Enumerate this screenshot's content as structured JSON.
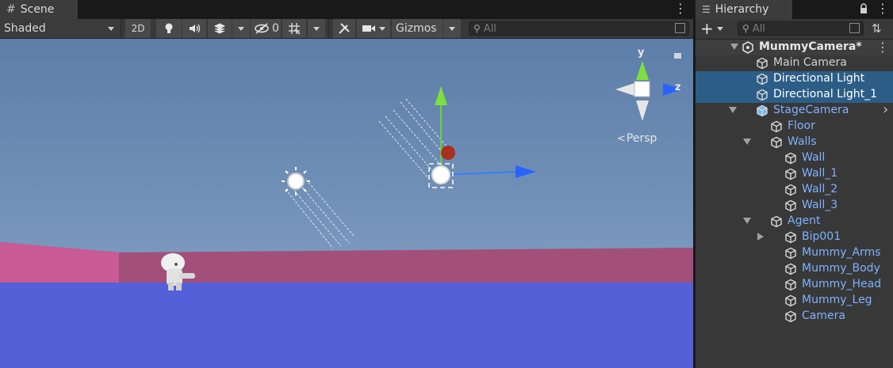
{
  "scene": {
    "tab_label": "Scene",
    "shading_mode": "Shaded",
    "mode_2d": "2D",
    "hidden_count": "0",
    "gizmos_label": "Gizmos",
    "search_placeholder": "All",
    "persp_label": "Persp",
    "axis_y": "y",
    "axis_z": "z"
  },
  "hierarchy": {
    "tab_label": "Hierarchy",
    "search_placeholder": "All",
    "scene_name": "MummyCamera*",
    "items": [
      {
        "label": "Main Camera",
        "depth": 1,
        "prefab": false,
        "selected": false,
        "expandable": false
      },
      {
        "label": "Directional Light",
        "depth": 1,
        "prefab": false,
        "selected": true,
        "expandable": false
      },
      {
        "label": "Directional Light_1",
        "depth": 1,
        "prefab": false,
        "selected": true,
        "expandable": false
      },
      {
        "label": "StageCamera",
        "depth": 1,
        "prefab": true,
        "selected": false,
        "expandable": true,
        "expanded": true
      },
      {
        "label": "Floor",
        "depth": 2,
        "prefab": true,
        "selected": false,
        "expandable": false
      },
      {
        "label": "Walls",
        "depth": 2,
        "prefab": true,
        "selected": false,
        "expandable": true,
        "expanded": true
      },
      {
        "label": "Wall",
        "depth": 3,
        "prefab": true,
        "selected": false,
        "expandable": false
      },
      {
        "label": "Wall_1",
        "depth": 3,
        "prefab": true,
        "selected": false,
        "expandable": false
      },
      {
        "label": "Wall_2",
        "depth": 3,
        "prefab": true,
        "selected": false,
        "expandable": false
      },
      {
        "label": "Wall_3",
        "depth": 3,
        "prefab": true,
        "selected": false,
        "expandable": false
      },
      {
        "label": "Agent",
        "depth": 2,
        "prefab": true,
        "selected": false,
        "expandable": true,
        "expanded": true
      },
      {
        "label": "Bip001",
        "depth": 3,
        "prefab": true,
        "selected": false,
        "expandable": true,
        "expanded": false
      },
      {
        "label": "Mummy_Arms",
        "depth": 3,
        "prefab": true,
        "selected": false,
        "expandable": false
      },
      {
        "label": "Mummy_Body",
        "depth": 3,
        "prefab": true,
        "selected": false,
        "expandable": false
      },
      {
        "label": "Mummy_Head",
        "depth": 3,
        "prefab": true,
        "selected": false,
        "expandable": false
      },
      {
        "label": "Mummy_Leg",
        "depth": 3,
        "prefab": true,
        "selected": false,
        "expandable": false
      },
      {
        "label": "Camera",
        "depth": 3,
        "prefab": true,
        "selected": false,
        "expandable": false
      }
    ]
  },
  "colors": {
    "selection": "#2c5d87",
    "prefab_text": "#7fb1ff",
    "panel_bg": "#383838",
    "floor": "#5560d8",
    "wall_left": "#c85a94",
    "wall_back": "#a2507a"
  }
}
